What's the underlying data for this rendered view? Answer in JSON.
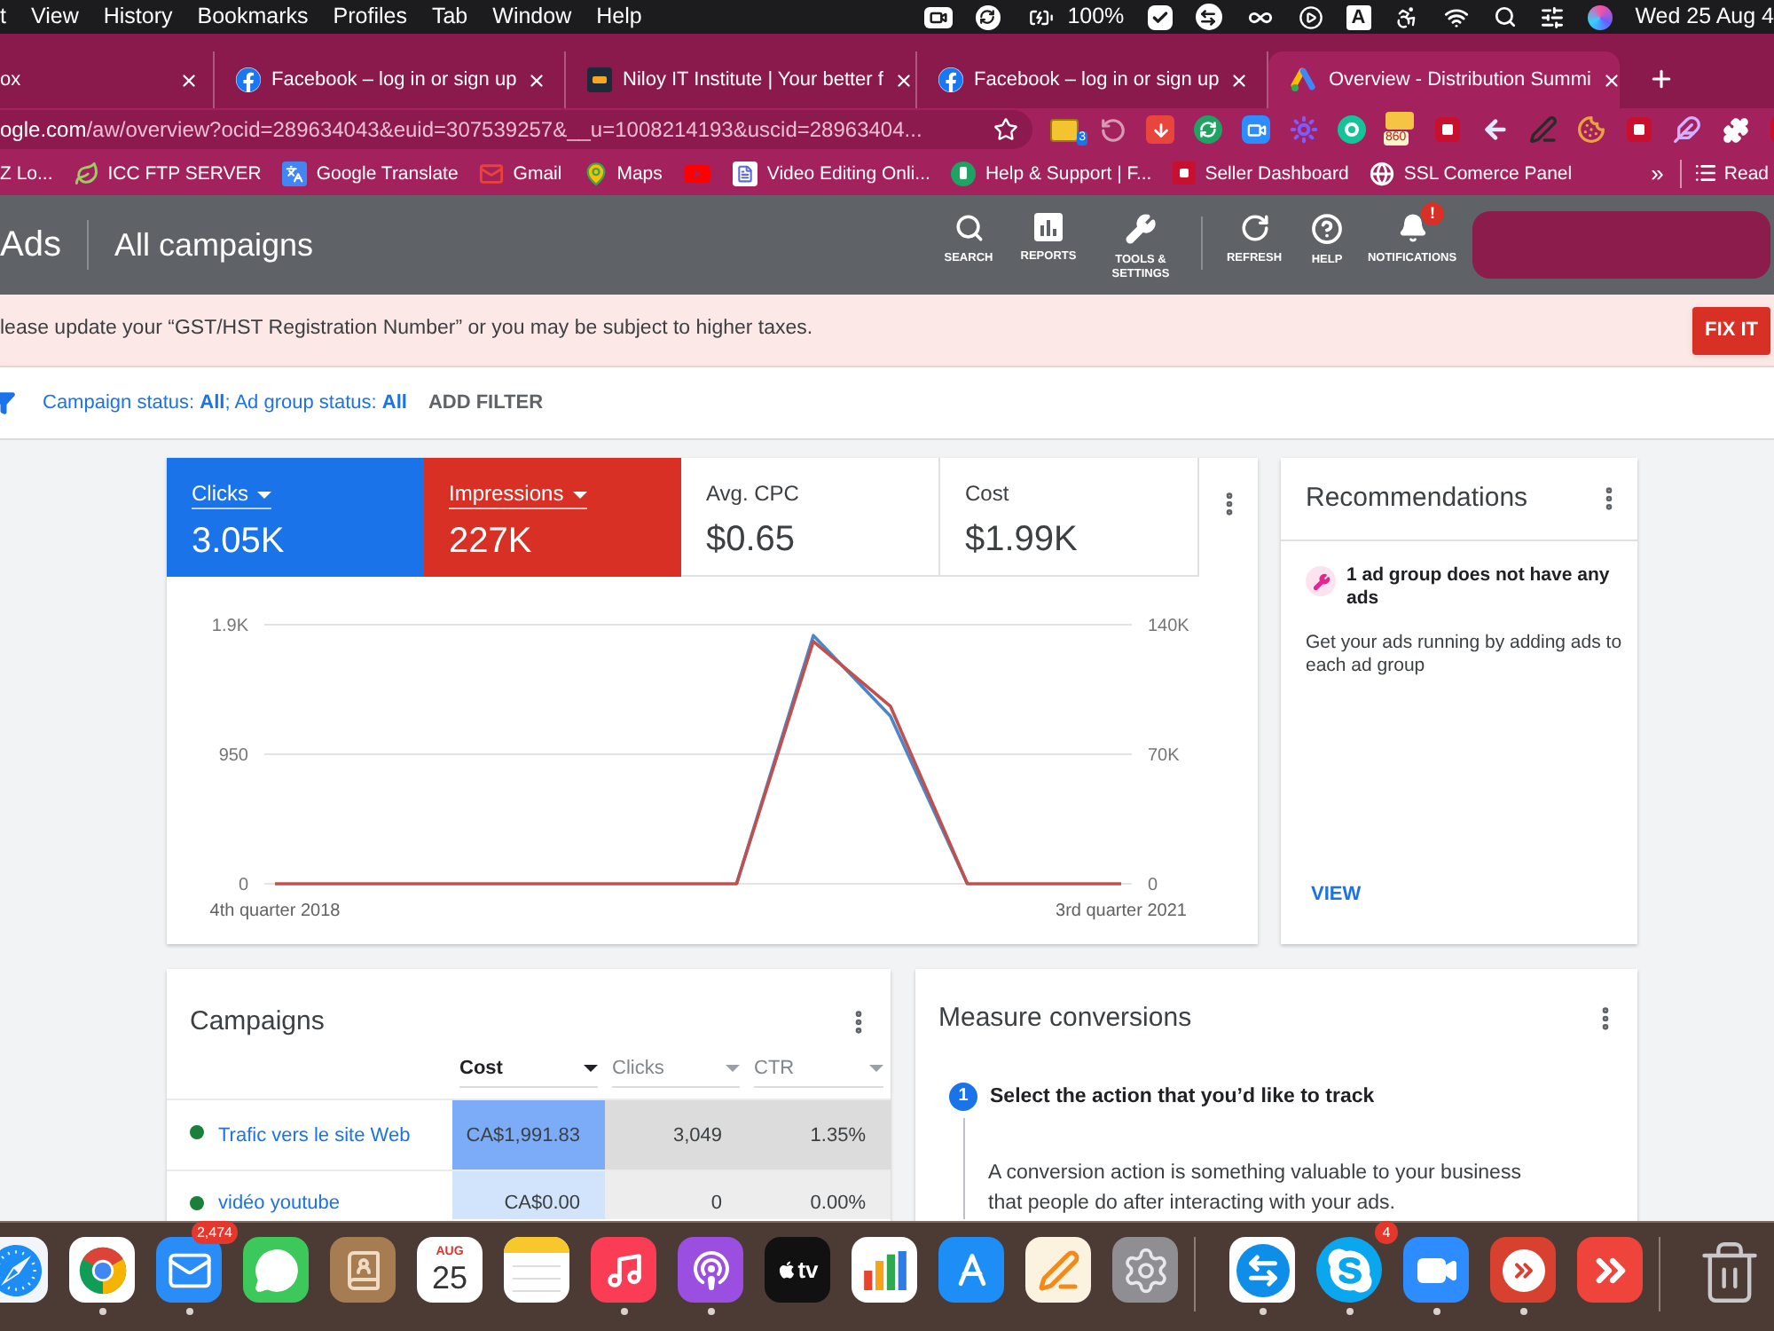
{
  "menu_bar": {
    "items": [
      "t",
      "View",
      "History",
      "Bookmarks",
      "Profiles",
      "Tab",
      "Window",
      "Help"
    ],
    "battery": "100%",
    "input_source": "A",
    "clock": "Wed 25 Aug 4"
  },
  "tabs": [
    {
      "title": "ox",
      "selected": false
    },
    {
      "title": "Facebook – log in or sign up",
      "selected": false
    },
    {
      "title": "Niloy IT Institute | Your better f",
      "selected": false
    },
    {
      "title": "Facebook – log in or sign up",
      "selected": false
    },
    {
      "title": "Overview - Distribution Summi",
      "selected": true
    }
  ],
  "toolbar": {
    "address": {
      "host": "ogle.com",
      "rest": "/aw/overview?ocid=289634043&euid=307539257&__u=1008214193&uscid=28963404..."
    },
    "extensions": [
      {
        "kind": "note",
        "badge": "3"
      },
      {
        "kind": "history"
      },
      {
        "kind": "download"
      },
      {
        "kind": "sync"
      },
      {
        "kind": "camera"
      },
      {
        "kind": "sun"
      },
      {
        "kind": "circle"
      },
      {
        "kind": "envelope",
        "badge": "860"
      },
      {
        "kind": "tile"
      },
      {
        "kind": "arrow"
      },
      {
        "kind": "pen"
      },
      {
        "kind": "cookie"
      },
      {
        "kind": "tile"
      },
      {
        "kind": "feather"
      },
      {
        "kind": "puzzle"
      },
      {
        "kind": "tile"
      }
    ]
  },
  "bookmarks": {
    "items": [
      {
        "label": "Z Lo..."
      },
      {
        "label": "ICC FTP SERVER"
      },
      {
        "label": "Google Translate"
      },
      {
        "label": "Gmail"
      },
      {
        "label": "Maps"
      },
      {
        "label": "Video Editing Onli..."
      },
      {
        "label": "Help & Support | F..."
      },
      {
        "label": "Seller Dashboard"
      },
      {
        "label": "SSL Comerce Panel"
      }
    ],
    "overflow": "»",
    "reading_list": "Read"
  },
  "ads_header": {
    "product": "Ads",
    "title": "All campaigns",
    "tools": [
      {
        "kind": "search",
        "label": "SEARCH"
      },
      {
        "kind": "reports",
        "label": "REPORTS"
      },
      {
        "kind": "tools",
        "label": "TOOLS & SETTINGS"
      },
      {
        "kind": "refresh",
        "label": "REFRESH"
      },
      {
        "kind": "help",
        "label": "HELP"
      },
      {
        "kind": "notifications",
        "label": "NOTIFICATIONS",
        "badge": "!"
      }
    ]
  },
  "banner": {
    "message": "lease update your “GST/HST Registration Number” or you may be subject to higher taxes.",
    "action": "FIX IT"
  },
  "filter_bar": {
    "summary": "Campaign status: **All**; Ad group status: **All**",
    "action": "ADD FILTER"
  },
  "performance": {
    "metrics": [
      {
        "label": "Clicks",
        "value": "3.05K",
        "selected": true,
        "color": "#1a73e8"
      },
      {
        "label": "Impressions",
        "value": "227K",
        "selected": true,
        "color": "#d93025"
      },
      {
        "label": "Avg. CPC",
        "value": "$0.65",
        "selected": false
      },
      {
        "label": "Cost",
        "value": "$1.99K",
        "selected": false
      }
    ],
    "chart_data": {
      "type": "line",
      "categories": [
        "4th quarter 2018",
        null,
        null,
        null,
        null,
        null,
        null,
        null,
        null,
        null,
        null,
        "3rd quarter 2021"
      ],
      "ylim": [
        0,
        1900
      ],
      "yticks": [
        {
          "value": 0,
          "label": "0"
        },
        {
          "value": 950,
          "label": "950"
        },
        {
          "value": 1900,
          "label": "1.9K"
        }
      ],
      "y2lim": [
        0,
        140000
      ],
      "y2ticks": [
        {
          "value": 0,
          "label": "0"
        },
        {
          "value": 70000,
          "label": "70K"
        },
        {
          "value": 140000,
          "label": "140K"
        }
      ],
      "series": [
        {
          "color": "#4a86c8",
          "values": [
            null,
            null,
            null,
            null,
            null,
            null,
            0,
            1820,
            1230,
            0,
            null,
            null
          ]
        },
        {
          "color": "#c0504d",
          "axis": "y2",
          "values": [
            0,
            0,
            0,
            0,
            0,
            0,
            0,
            131000,
            96000,
            0,
            0,
            0
          ]
        }
      ]
    }
  },
  "recommendations": {
    "title": "Recommendations",
    "items": [
      {
        "title": "1 ad group does not have any ads",
        "description": "Get your ads running by adding ads to each ad group"
      }
    ],
    "action": "VIEW"
  },
  "campaigns": {
    "title": "Campaigns",
    "columns": [
      {
        "label": "Cost",
        "sorted": true
      },
      {
        "label": "Clicks",
        "sorted": false
      },
      {
        "label": "CTR",
        "sorted": false
      }
    ],
    "rows": [
      {
        "name": "Trafic vers le site Web",
        "highlighted": true,
        "cells": [
          "CA$1,991.83",
          "3,049",
          "1.35%"
        ]
      },
      {
        "name": "vidéo youtube",
        "highlighted": false,
        "cells": [
          "CA$0.00",
          "0",
          "0.00%"
        ]
      }
    ]
  },
  "conversions": {
    "title": "Measure conversions",
    "steps": [
      {
        "number": "1",
        "title": "Select the action that you’d like to track",
        "description": "A conversion action is something valuable to your business that people do after interacting with your ads."
      }
    ]
  },
  "dock": {
    "apps": [
      {
        "kind": "safari",
        "running": false
      },
      {
        "kind": "chrome",
        "running": true
      },
      {
        "kind": "mail",
        "running": true,
        "badge": "2,474"
      },
      {
        "kind": "messages",
        "running": false
      },
      {
        "kind": "contacts",
        "running": false
      },
      {
        "kind": "calendar",
        "running": false,
        "month": "AUG",
        "day": "25"
      },
      {
        "kind": "notes",
        "running": false
      },
      {
        "kind": "music",
        "running": true
      },
      {
        "kind": "podcasts",
        "running": true
      },
      {
        "kind": "tv",
        "running": false,
        "label": "tv"
      },
      {
        "kind": "numbers",
        "running": false
      },
      {
        "kind": "appstore",
        "running": false
      },
      {
        "kind": "pages",
        "running": false
      },
      {
        "kind": "settings",
        "running": false
      }
    ],
    "recent": [
      {
        "kind": "teamviewer",
        "running": true
      },
      {
        "kind": "skype",
        "running": true,
        "badge": "4"
      },
      {
        "kind": "zoom",
        "running": true
      },
      {
        "kind": "remote",
        "running": true
      },
      {
        "kind": "anydesk",
        "running": false
      }
    ]
  }
}
